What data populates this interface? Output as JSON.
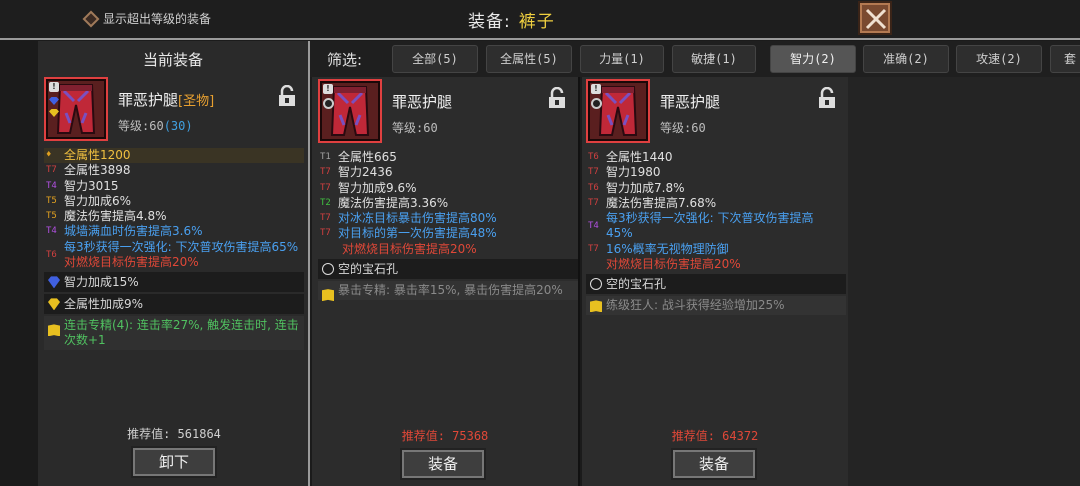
{
  "topbar": {
    "show_over_level_label": "显示超出等级的装备",
    "title_label": "装备:",
    "title_item": "裤子"
  },
  "current": {
    "panel_title": "当前装备",
    "item_name": "罪恶护腿",
    "item_tag": "[圣物]",
    "level_label": "等级:60",
    "level_bonus": "(30)",
    "stats": [
      {
        "tier": "",
        "text": "全属性1200",
        "color": "yellow"
      },
      {
        "tier": "T7",
        "text": "全属性3898",
        "color": "white"
      },
      {
        "tier": "T4",
        "text": "智力3015",
        "color": "white"
      },
      {
        "tier": "T5",
        "text": "智力加成6%",
        "color": "white"
      },
      {
        "tier": "T5",
        "text": "魔法伤害提高4.8%",
        "color": "white"
      },
      {
        "tier": "T4",
        "text": "城墙满血时伤害提高3.6%",
        "color": "blue"
      },
      {
        "tier": "T6",
        "text": "每3秒获得一次强化: 下次普攻伤害提高65%",
        "color": "blue"
      },
      {
        "tier": "",
        "text": "对燃烧目标伤害提高20%",
        "color": "red"
      }
    ],
    "gem1": "智力加成15%",
    "gem2": "全属性加成9%",
    "note": "连击专精(4): 连击率27%, 触发连击时, 连击次数+1",
    "score": "推荐值: 561864",
    "button": "卸下"
  },
  "filter": {
    "label": "筛选:",
    "tabs": [
      "全部(5)",
      "全属性(5)",
      "力量(1)",
      "敏捷(1)",
      "智力(2)",
      "准确(2)",
      "攻速(2)",
      "套"
    ]
  },
  "candidate1": {
    "item_name": "罪恶护腿",
    "level_label": "等级:60",
    "stats": [
      {
        "tier": "T1",
        "text": "全属性665",
        "color": "white"
      },
      {
        "tier": "T7",
        "text": "智力2436",
        "color": "white"
      },
      {
        "tier": "T7",
        "text": "智力加成9.6%",
        "color": "white"
      },
      {
        "tier": "T2",
        "text": "魔法伤害提高3.36%",
        "color": "white"
      },
      {
        "tier": "T7",
        "text": "对冰冻目标暴击伤害提高80%",
        "color": "blue"
      },
      {
        "tier": "T7",
        "text": "对目标的第一次伤害提高48%",
        "color": "blue"
      },
      {
        "tier": "",
        "text": "对燃烧目标伤害提高20%",
        "color": "red"
      }
    ],
    "socket": "空的宝石孔",
    "note": "暴击专精: 暴击率15%, 暴击伤害提高20%",
    "score": "推荐值: 75368",
    "button": "装备"
  },
  "candidate2": {
    "item_name": "罪恶护腿",
    "level_label": "等级:60",
    "stats": [
      {
        "tier": "T6",
        "text": "全属性1440",
        "color": "white"
      },
      {
        "tier": "T7",
        "text": "智力1980",
        "color": "white"
      },
      {
        "tier": "T6",
        "text": "智力加成7.8%",
        "color": "white"
      },
      {
        "tier": "T7",
        "text": "魔法伤害提高7.68%",
        "color": "white"
      },
      {
        "tier": "T4",
        "text": "每3秒获得一次强化: 下次普攻伤害提高45%",
        "color": "blue"
      },
      {
        "tier": "T7",
        "text": "16%概率无视物理防御",
        "color": "blue"
      },
      {
        "tier": "",
        "text": "对燃烧目标伤害提高20%",
        "color": "red"
      }
    ],
    "socket": "空的宝石孔",
    "note": "练级狂人: 战斗获得经验增加25%",
    "score": "推荐值: 64372",
    "button": "装备"
  }
}
